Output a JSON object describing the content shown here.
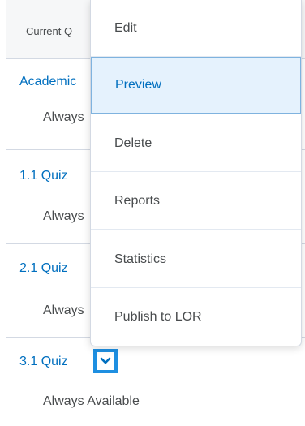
{
  "table": {
    "header_label": "Current Q",
    "rows": [
      {
        "title": "Academic",
        "status": "Always"
      },
      {
        "title": "1.1 Quiz",
        "status": "Always"
      },
      {
        "title": "2.1 Quiz",
        "status": "Always"
      },
      {
        "title": "3.1 Quiz",
        "status": "Always Available"
      }
    ]
  },
  "context_menu": {
    "trigger_icon": "chevron-down-icon",
    "items": [
      {
        "label": "Edit"
      },
      {
        "label": "Preview",
        "active": true
      },
      {
        "label": "Delete"
      },
      {
        "label": "Reports"
      },
      {
        "label": "Statistics"
      },
      {
        "label": "Publish to LOR"
      }
    ]
  },
  "colors": {
    "link": "#006fbf",
    "text": "#494c4e",
    "focus": "#1e8fe1",
    "active_item_bg": "#e5f2fd"
  }
}
